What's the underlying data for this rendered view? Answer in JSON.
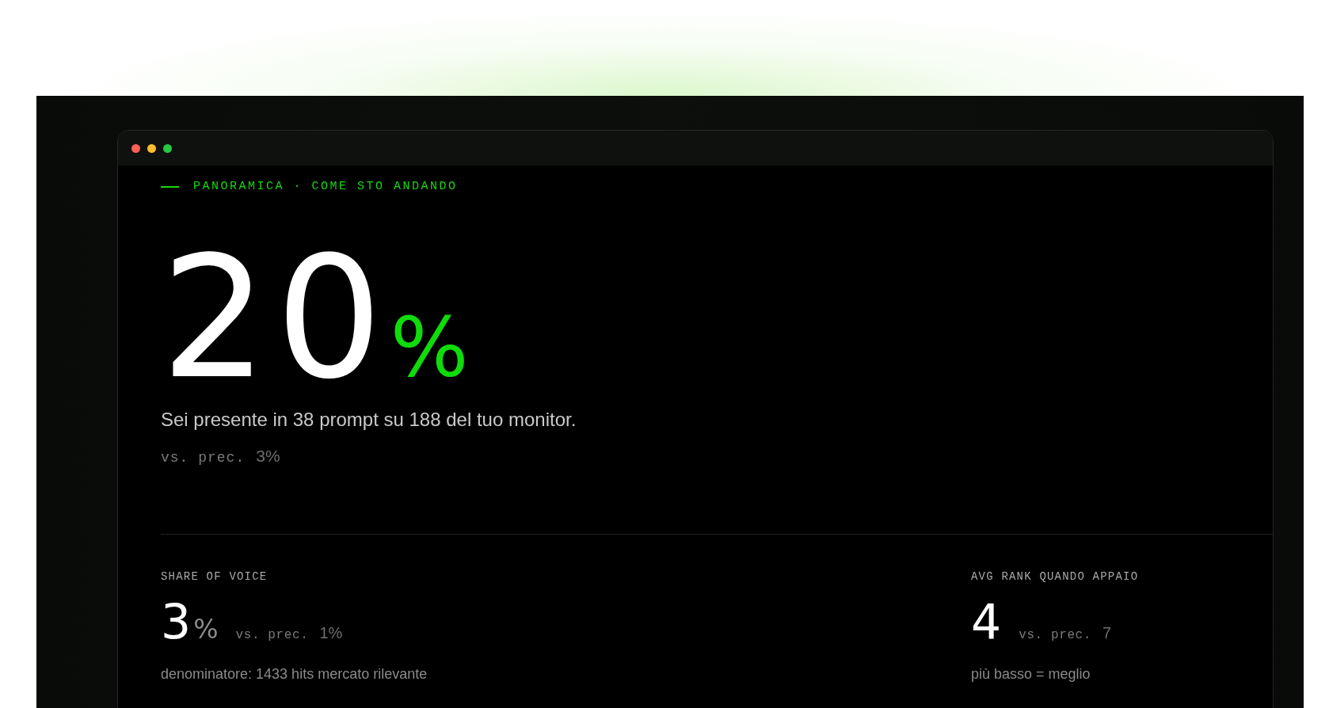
{
  "window": {
    "controls": [
      {
        "color": "#ff5f57"
      },
      {
        "color": "#febc2e"
      },
      {
        "color": "#28c840"
      }
    ]
  },
  "eyebrow": "PANORAMICA · COME STO ANDANDO",
  "hero": {
    "value": "20",
    "unit": "%",
    "description": "Sei presente in 38 prompt su 188 del tuo monitor.",
    "comparison_label": "vs. prec.",
    "comparison_value": "3%"
  },
  "stats": [
    {
      "label": "SHARE OF VOICE",
      "value": "3",
      "unit": "%",
      "comparison_label": "vs. prec.",
      "comparison_value": "1%",
      "note": "denominatore: 1433 hits mercato rilevante"
    },
    {
      "label": "AVG RANK QUANDO APPAIO",
      "value": "4",
      "comparison_label": "vs. prec.",
      "comparison_value": "7",
      "note": "più basso = meglio"
    }
  ]
}
